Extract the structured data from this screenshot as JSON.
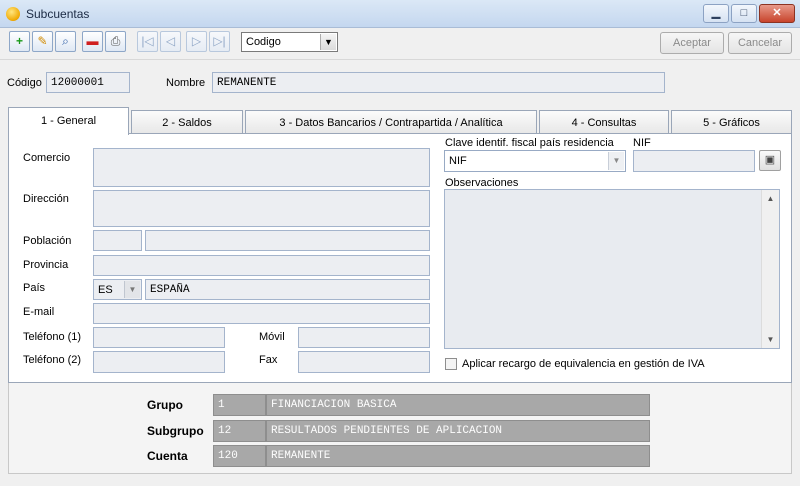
{
  "window": {
    "title": "Subcuentas"
  },
  "titlebar": {
    "minimize": "▁",
    "maximize": "□",
    "close": "✕"
  },
  "toolbar": {
    "sort_select": "Codigo",
    "accept": "Aceptar",
    "cancel": "Cancelar"
  },
  "header": {
    "code_label": "Código",
    "code_value": "12000001",
    "name_label": "Nombre",
    "name_value": "REMANENTE"
  },
  "tabs": [
    {
      "label": "1 - General"
    },
    {
      "label": "2 - Saldos"
    },
    {
      "label": "3 - Datos Bancarios / Contrapartida / Analítica"
    },
    {
      "label": "4 - Consultas"
    },
    {
      "label": "5 - Gráficos"
    }
  ],
  "general": {
    "comercio_label": "Comercio",
    "direccion_label": "Dirección",
    "poblacion_label": "Población",
    "provincia_label": "Provincia",
    "pais_label": "País",
    "pais_code": "ES",
    "pais_name": "ESPAÑA",
    "email_label": "E-mail",
    "telefono1_label": "Teléfono (1)",
    "movil_label": "Móvil",
    "telefono2_label": "Teléfono (2)",
    "fax_label": "Fax",
    "clave_label": "Clave identif. fiscal país residencia",
    "clave_value": "NIF",
    "nif_label": "NIF",
    "observaciones_label": "Observaciones",
    "recargo_label": "Aplicar recargo de equivalencia en gestión de IVA"
  },
  "account": {
    "grupo_label": "Grupo",
    "grupo_code": "1",
    "grupo_name": "FINANCIACION BASICA",
    "subgrupo_label": "Subgrupo",
    "subgrupo_code": "12",
    "subgrupo_name": "RESULTADOS PENDIENTES DE APLICACION",
    "cuenta_label": "Cuenta",
    "cuenta_code": "120",
    "cuenta_name": "REMANENTE"
  },
  "colors": {
    "titlebar": "#c4d7ef",
    "field_bg": "#eceef2",
    "readonly_bg": "#a8a8a8"
  },
  "icons": [
    "new-icon",
    "edit-icon",
    "search-icon",
    "delete-icon",
    "print-icon",
    "first-icon",
    "prev-icon",
    "next-icon",
    "last-icon",
    "card-icon"
  ]
}
